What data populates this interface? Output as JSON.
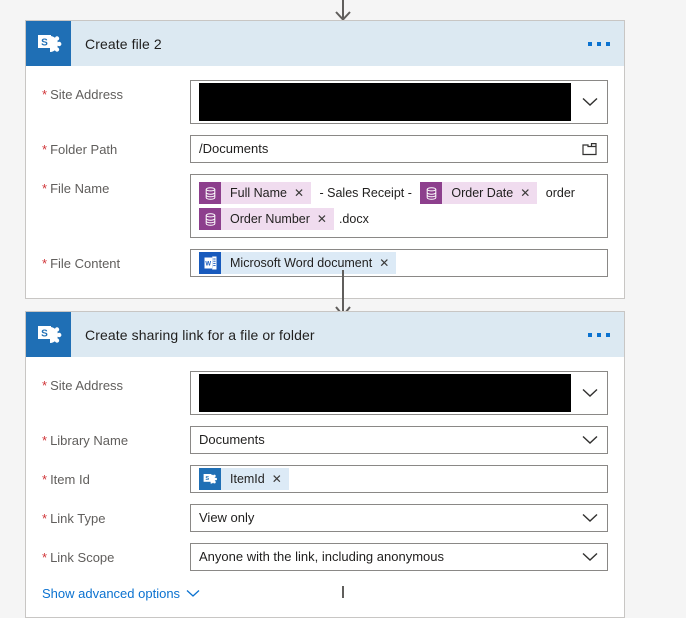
{
  "theme": {
    "page_background": "#f5f5f5",
    "card_header_background": "#dce9f2",
    "app_tile_color": "#1f6fb5",
    "required_marker_color": "#d13438",
    "link_color": "#0b72d0",
    "token_purple": "#8d3f8d",
    "token_purple_body": "#f0dcef",
    "token_blue": "#1f6fb5",
    "token_blue_body": "#dceaf6",
    "word_blue": "#185abd"
  },
  "connectors": [
    {
      "name": "top-connector",
      "arrow": "down"
    },
    {
      "name": "middle-connector",
      "arrow": "down"
    },
    {
      "name": "bottom-connector",
      "arrow": "line"
    }
  ],
  "cards": [
    {
      "id": "create-file-2",
      "title": "Create file 2",
      "app_icon": "sharepoint-icon",
      "menu_icon": "ellipsis-icon",
      "fields": [
        {
          "name": "site-address",
          "label": "Site Address",
          "required_marker": "*",
          "type": "dropdown-redacted",
          "value": "",
          "redacted": true,
          "chevron_icon": "chevron-down-icon"
        },
        {
          "name": "folder-path",
          "label": "Folder Path",
          "required_marker": "*",
          "type": "text-picker",
          "value": "/Documents",
          "trailing_icon": "folder-icon"
        },
        {
          "name": "file-name",
          "label": "File Name",
          "required_marker": "*",
          "type": "token-field",
          "tokens": [
            {
              "kind": "chip",
              "icon": "database-icon",
              "color": "purple",
              "label": "Full Name",
              "remove_label": "✕"
            },
            {
              "kind": "text",
              "label": " - Sales Receipt - "
            },
            {
              "kind": "chip",
              "icon": "database-icon",
              "color": "purple",
              "label": "Order Date",
              "remove_label": "✕"
            },
            {
              "kind": "text",
              "label": " order"
            },
            {
              "kind": "chip",
              "icon": "database-icon",
              "color": "purple",
              "label": "Order Number",
              "remove_label": "✕"
            },
            {
              "kind": "text",
              "label": ".docx"
            }
          ]
        },
        {
          "name": "file-content",
          "label": "File Content",
          "required_marker": "*",
          "type": "token-field",
          "tokens": [
            {
              "kind": "chip",
              "icon": "word-icon",
              "color": "word",
              "label": "Microsoft Word document",
              "remove_label": "✕"
            }
          ]
        }
      ]
    },
    {
      "id": "create-sharing-link",
      "title": "Create sharing link for a file or folder",
      "app_icon": "sharepoint-icon",
      "menu_icon": "ellipsis-icon",
      "fields": [
        {
          "name": "site-address",
          "label": "Site Address",
          "required_marker": "*",
          "type": "dropdown-redacted",
          "value": "",
          "redacted": true,
          "chevron_icon": "chevron-down-icon"
        },
        {
          "name": "library-name",
          "label": "Library Name",
          "required_marker": "*",
          "type": "dropdown",
          "value": "Documents",
          "chevron_icon": "chevron-down-icon"
        },
        {
          "name": "item-id",
          "label": "Item Id",
          "required_marker": "*",
          "type": "token-field",
          "tokens": [
            {
              "kind": "chip",
              "icon": "sharepoint-icon",
              "color": "blue",
              "label": "ItemId",
              "remove_label": "✕"
            }
          ]
        },
        {
          "name": "link-type",
          "label": "Link Type",
          "required_marker": "*",
          "type": "dropdown",
          "value": "View only",
          "chevron_icon": "chevron-down-icon"
        },
        {
          "name": "link-scope",
          "label": "Link Scope",
          "required_marker": "*",
          "type": "dropdown",
          "value": "Anyone with the link, including anonymous",
          "chevron_icon": "chevron-down-icon"
        }
      ],
      "advanced_options": {
        "label": "Show advanced options",
        "icon": "chevron-down-icon"
      }
    }
  ]
}
